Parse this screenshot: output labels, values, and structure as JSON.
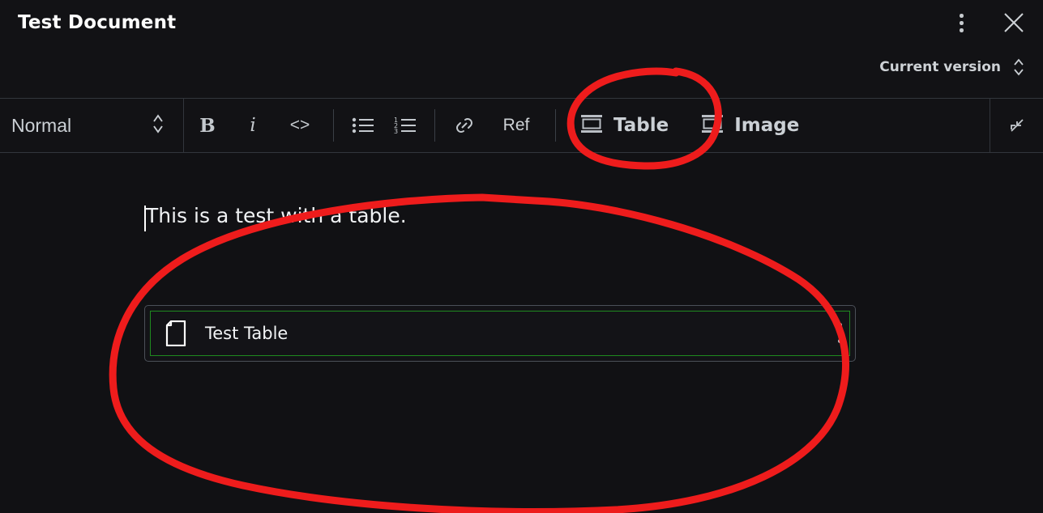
{
  "window": {
    "title": "Test Document",
    "menu_icon": "kebab-menu-icon",
    "close_icon": "close-icon"
  },
  "version_bar": {
    "label": "Current version",
    "selector_icon": "chevron-up-down-icon"
  },
  "toolbar": {
    "style_select": {
      "value": "Normal",
      "icon": "chevron-up-down-icon"
    },
    "bold_label": "B",
    "italic_label": "i",
    "code_label": "<>",
    "bullet_list_icon": "bullet-list-icon",
    "numbered_list_icon": "numbered-list-icon",
    "link_icon": "link-icon",
    "ref_label": "Ref",
    "table_label": "Table",
    "table_icon": "table-icon",
    "image_label": "Image",
    "image_icon": "image-icon",
    "collapse_icon": "collapse-arrows-icon"
  },
  "document": {
    "paragraph": "This is a test with a table.",
    "embed": {
      "title": "Test Table",
      "icon": "file-document-icon",
      "menu_icon": "kebab-menu-icon",
      "highlight_color": "#1f8a1f"
    }
  },
  "annotations": {
    "color": "#ee1c1c",
    "shapes": [
      {
        "name": "circle-around-table-button"
      },
      {
        "name": "circle-around-test-table-embed"
      }
    ]
  }
}
